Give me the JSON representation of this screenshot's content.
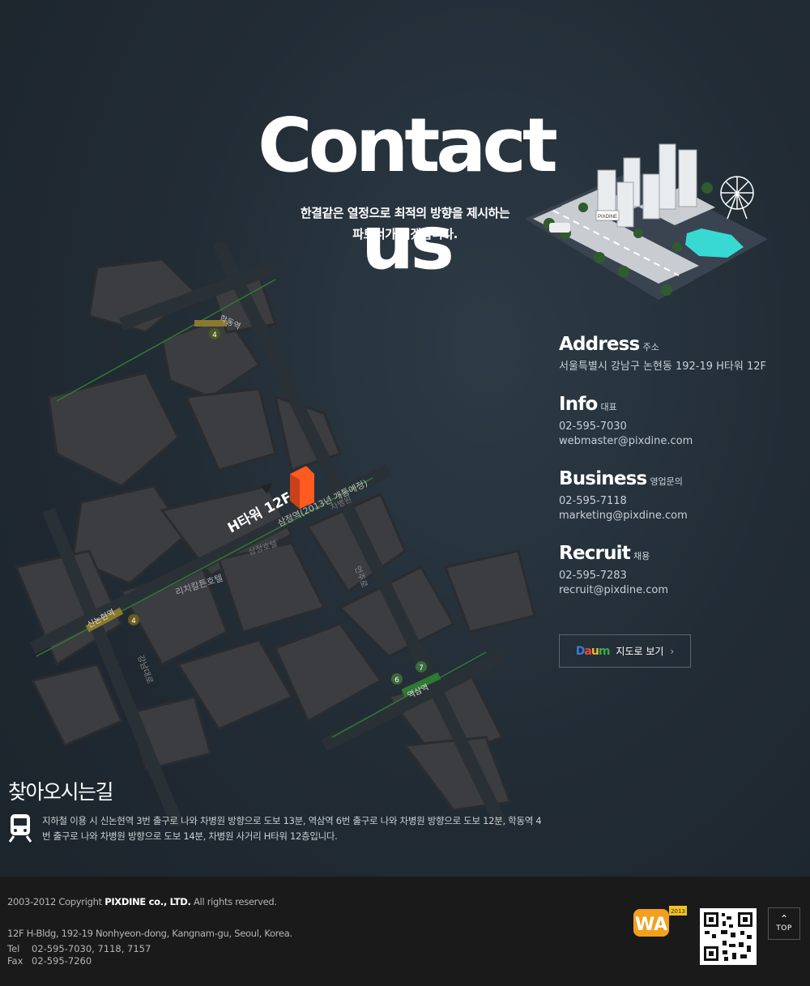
{
  "title": "Contact us",
  "subtitle_line1": "한결같은 열정으로 최적의 방향을 제시하는",
  "subtitle_line2": "파트너가 되겠습니다.",
  "city_sign": "PIXDINE",
  "map": {
    "building_label": "H타워 12F",
    "stations": {
      "hakdong": "학동역",
      "sinnonhyeon": "신논현역",
      "yeoksam": "역삼역",
      "samjeong": "삼정역(2013년 개통예정)"
    },
    "line_numbers": {
      "hakdong": "4",
      "sinnonhyeon": "4",
      "yeoksam_a": "6",
      "yeoksam_b": "7"
    },
    "landmarks": {
      "ritz": "리치칼튼호텔",
      "samjeong_hotel": "삼정호텔",
      "hospital": "차병원",
      "road1": "언주로",
      "road2": "강남대로"
    }
  },
  "sections": [
    {
      "heading": "Address",
      "sub": "주소",
      "lines": [
        "서울특별시 강남구 논현동 192-19 H타워 12F"
      ]
    },
    {
      "heading": "Info",
      "sub": "대표",
      "lines": [
        "02-595-7030",
        "webmaster@pixdine.com"
      ]
    },
    {
      "heading": "Business",
      "sub": "영업문의",
      "lines": [
        "02-595-7118",
        "marketing@pixdine.com"
      ]
    },
    {
      "heading": "Recruit",
      "sub": "채용",
      "lines": [
        "02-595-7283",
        "recruit@pixdine.com"
      ]
    }
  ],
  "daum": {
    "logo": "Daum",
    "label": "지도로 보기",
    "chevron": "›"
  },
  "directions": {
    "title": "찾아오시는길",
    "text": "지하철 이용 시 신논현역 3번 출구로 나와 차병원 방향으로 도보 13분, 역삼역 6번 출구로 나와 차병원 방향으로 도보 12분, 학동역 4번 출구로 나와 차병원 방향으로 도보 14분, 차병원 사거리 H타워 12층입니다."
  },
  "footer": {
    "copyright_prefix": "2003-2012 Copyright ",
    "company": "PIXDINE co., LTD.",
    "copyright_suffix": " All rights reserved.",
    "address": "12F H-Bldg, 192-19 Nonhyeon-dong, Kangnam-gu, Seoul, Korea.",
    "tel_label": "Tel",
    "tel": "02-595-7030, 7118, 7157",
    "fax_label": "Fax",
    "fax": "02-595-7260",
    "award_logo": "WA",
    "award_year": "2013",
    "top_label": "TOP"
  },
  "colors": {
    "building": "#ff5a1f",
    "subway_line": "#2f7a32",
    "map_block": "#3a3c3f"
  }
}
